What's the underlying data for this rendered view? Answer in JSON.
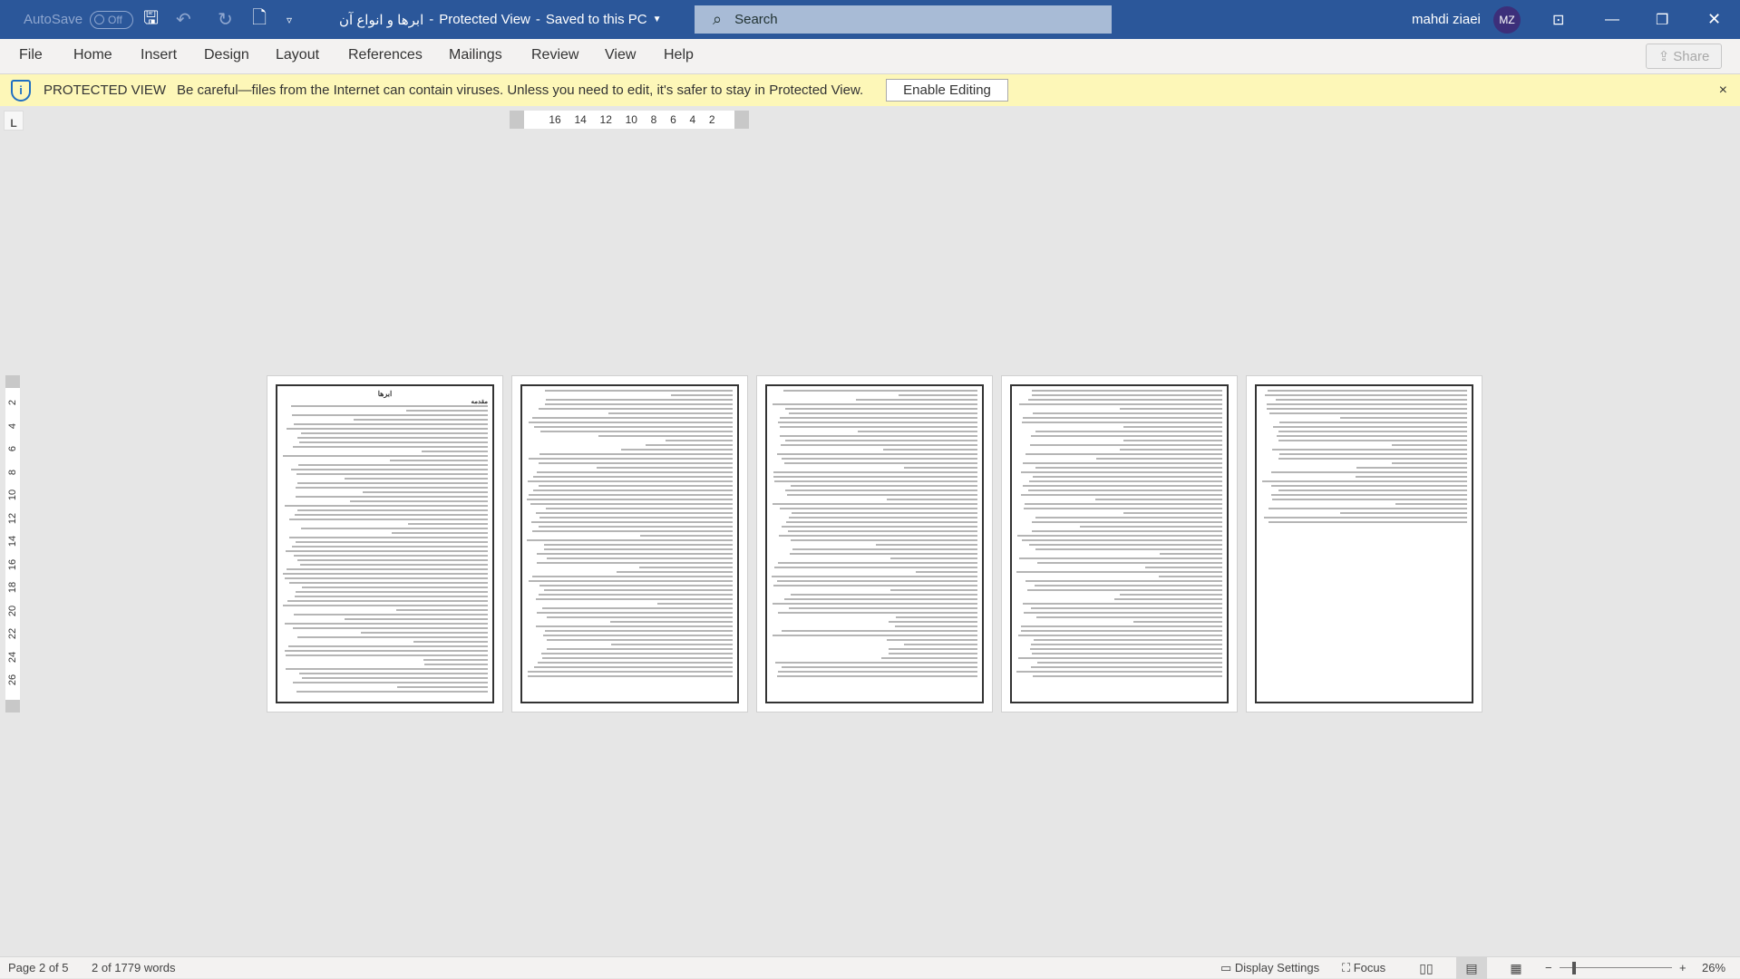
{
  "titlebar": {
    "autosave": "AutoSave",
    "autosave_state": "Off",
    "doc_title": "ابرها و انواع آن",
    "sep1": "-",
    "mode": "Protected View",
    "sep2": "-",
    "save_status": "Saved to this PC",
    "search_placeholder": "Search",
    "user_name": "mahdi ziaei",
    "user_initials": "MZ"
  },
  "menu": {
    "tabs": [
      "File",
      "Home",
      "Insert",
      "Design",
      "Layout",
      "References",
      "Mailings",
      "Review",
      "View",
      "Help"
    ],
    "share": "Share"
  },
  "protected_view": {
    "label": "PROTECTED VIEW",
    "message": "Be careful—files from the Internet can contain viruses. Unless you need to edit, it's safer to stay in Protected View.",
    "button": "Enable Editing",
    "close": "×"
  },
  "ruler": {
    "horizontal": [
      "16",
      "14",
      "12",
      "10",
      "8",
      "6",
      "4",
      "2"
    ],
    "vertical": [
      "2",
      "4",
      "6",
      "8",
      "10",
      "12",
      "14",
      "16",
      "18",
      "20",
      "22",
      "24",
      "26"
    ]
  },
  "pages": {
    "count": 5,
    "page1_title": "ابرها",
    "page1_heading": "مقدمه"
  },
  "status": {
    "page": "Page 2 of 5",
    "words": "2 of 1779 words",
    "display_settings": "Display Settings",
    "focus": "Focus",
    "zoom": "26%",
    "zoom_minus": "−",
    "zoom_plus": "+"
  }
}
